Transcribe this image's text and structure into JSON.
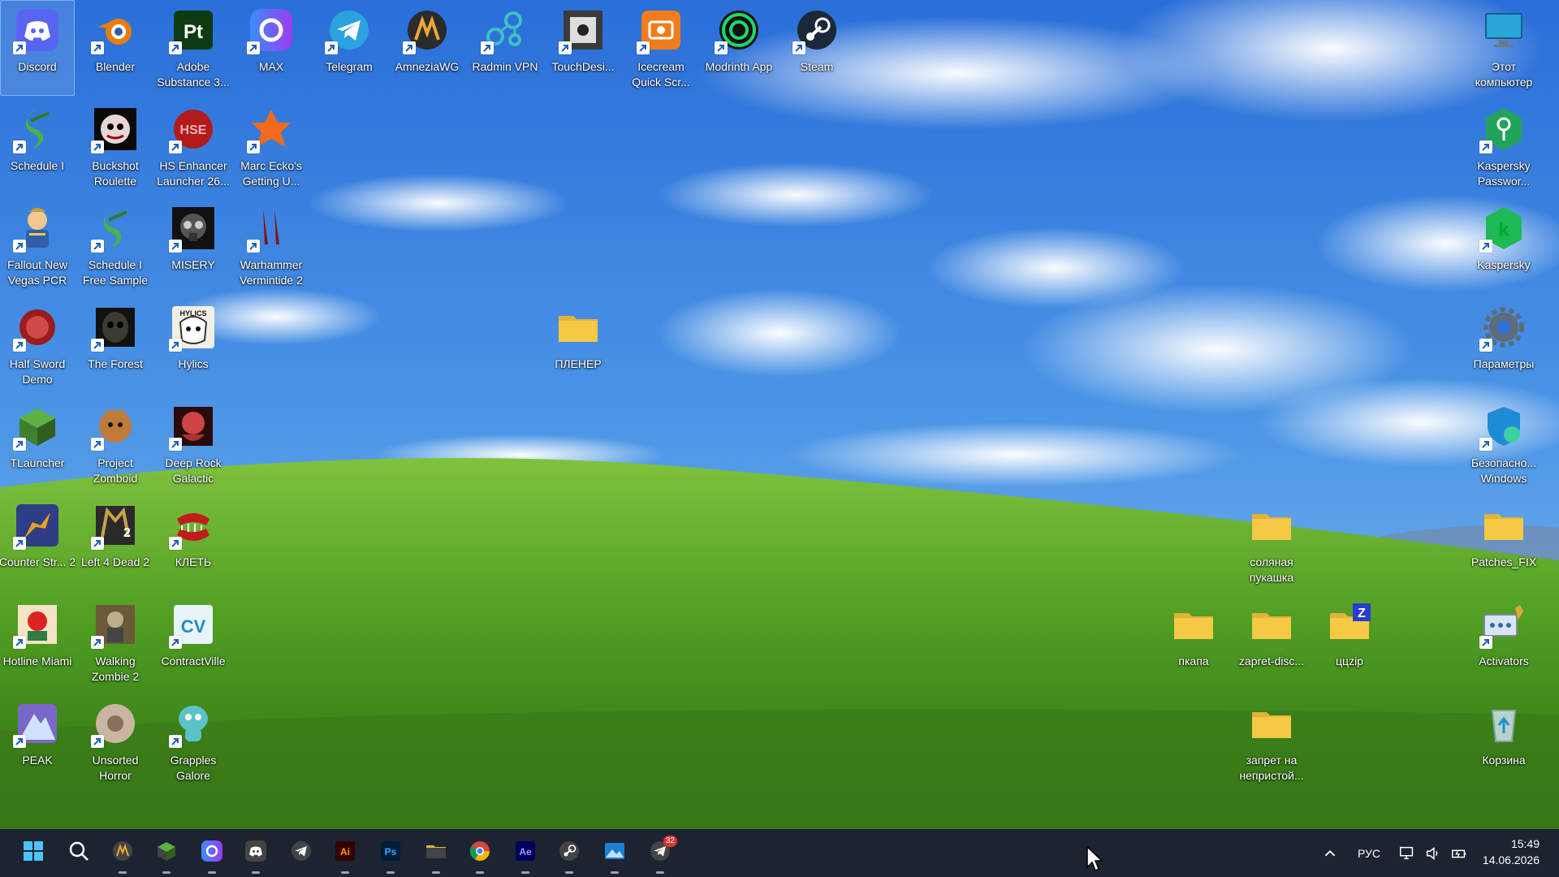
{
  "desktop": {
    "icons": [
      {
        "label": "Discord",
        "glyph": "discord",
        "color": "#5865f2"
      },
      {
        "label": "Blender",
        "glyph": "blender",
        "color": "#e87d0d"
      },
      {
        "label": "Adobe Substance 3...",
        "glyph": "Pt",
        "color": "#0f3b14"
      },
      {
        "label": "MAX",
        "glyph": "max",
        "color": "#6b46e5"
      },
      {
        "label": "Telegram",
        "glyph": "telegram",
        "color": "#2aa3e0"
      },
      {
        "label": "AmneziaWG",
        "glyph": "amnezia",
        "color": "#2b2b2b"
      },
      {
        "label": "Radmin VPN",
        "glyph": "radmin",
        "color": "#3cc1c5"
      },
      {
        "label": "TouchDesi...",
        "glyph": "touchdesigner",
        "color": "#3a3a3a"
      },
      {
        "label": "Icecream Quick Scr...",
        "glyph": "icecream",
        "color": "#f07c1b"
      },
      {
        "label": "Modrinth App",
        "glyph": "modrinth",
        "color": "#1bd96a"
      },
      {
        "label": "Steam",
        "glyph": "steam",
        "color": "#1b2838"
      },
      {
        "label": "Этот компьютер",
        "glyph": "pc",
        "color": "#2ba6d8"
      },
      {
        "label": "Schedule I",
        "glyph": "schedule",
        "color": "#4fae4b"
      },
      {
        "label": "Buckshot Roulette",
        "glyph": "buckshot",
        "color": "#3a1212"
      },
      {
        "label": "HS Enhancer Launcher 26...",
        "glyph": "hse",
        "color": "#b31b1b"
      },
      {
        "label": "Marc Ecko's Getting U...",
        "glyph": "ecko",
        "color": "#f26a1b"
      },
      {
        "label": "Kaspersky Passwor...",
        "glyph": "kpass",
        "color": "#21a35a"
      },
      {
        "label": "Fallout New Vegas PCR",
        "glyph": "fallout",
        "color": "#c9a34a"
      },
      {
        "label": "Schedule I Free Sample",
        "glyph": "schedule",
        "color": "#4fae4b"
      },
      {
        "label": "MISERY",
        "glyph": "misery",
        "color": "#2a2a2a"
      },
      {
        "label": "Warhammer Vermintide 2",
        "glyph": "vermintide",
        "color": "#8b1010"
      },
      {
        "label": "Kaspersky",
        "glyph": "kaspersky",
        "color": "#1db954"
      },
      {
        "label": "Half Sword Demo",
        "glyph": "halfsword",
        "color": "#9b1c1c"
      },
      {
        "label": "The Forest",
        "glyph": "forest",
        "color": "#3b3b30"
      },
      {
        "label": "Hylics",
        "glyph": "hylics",
        "color": "#f2f0e6"
      },
      {
        "label": "ПЛЕНЕР",
        "glyph": "folder",
        "color": "#f5c944"
      },
      {
        "label": "Параметры",
        "glyph": "gear",
        "color": "#5d6b7a"
      },
      {
        "label": "TLauncher",
        "glyph": "tlauncher",
        "color": "#3f7f2e"
      },
      {
        "label": "Project Zomboid",
        "glyph": "zomboid",
        "color": "#c07a3a"
      },
      {
        "label": "Deep Rock Galactic",
        "glyph": "drg",
        "color": "#7b1c1c"
      },
      {
        "label": "Безопасно... Windows",
        "glyph": "defender",
        "color": "#1f8ad6"
      },
      {
        "label": "Counter Str... 2",
        "glyph": "cs2",
        "color": "#e8a020"
      },
      {
        "label": "Left 4 Dead 2",
        "glyph": "l4d2",
        "color": "#2a2a2a"
      },
      {
        "label": "КЛЕТЬ",
        "glyph": "klet",
        "color": "#c21b1b"
      },
      {
        "label": "соляная пукашка",
        "glyph": "folder",
        "color": "#f5c944"
      },
      {
        "label": "Patches_FIX",
        "glyph": "folder",
        "color": "#f5c944"
      },
      {
        "label": "Hotline Miami",
        "glyph": "hotline",
        "color": "#2e7d43"
      },
      {
        "label": "Walking Zombie 2",
        "glyph": "walkingzombie",
        "color": "#6b5a3a"
      },
      {
        "label": "ContractVille",
        "glyph": "cv",
        "color": "#1f8fbf"
      },
      {
        "label": "пкапа",
        "glyph": "folder",
        "color": "#f5c944"
      },
      {
        "label": "zapret-disc...",
        "glyph": "folder",
        "color": "#f5c944"
      },
      {
        "label": "ццzip",
        "glyph": "zip",
        "color": "#f5c944"
      },
      {
        "label": "Activators",
        "glyph": "activators",
        "color": "#d9e6f2"
      },
      {
        "label": "PEAK",
        "glyph": "peak",
        "color": "#7a68c8"
      },
      {
        "label": "Unsorted Horror",
        "glyph": "unsorted",
        "color": "#c9b6a2"
      },
      {
        "label": "Grapples Galore",
        "glyph": "grapples",
        "color": "#5ac2c9"
      },
      {
        "label": "запрет на непристой...",
        "glyph": "folder",
        "color": "#f5c944"
      },
      {
        "label": "Корзина",
        "glyph": "recycle",
        "color": "#d6e8f5"
      }
    ]
  },
  "taskbar": {
    "apps": [
      {
        "name": "start-button",
        "glyph": "start"
      },
      {
        "name": "search-button",
        "glyph": "search"
      },
      {
        "name": "amnezia",
        "glyph": "amnezia"
      },
      {
        "name": "tlauncher",
        "glyph": "tlauncher"
      },
      {
        "name": "max",
        "glyph": "max"
      },
      {
        "name": "discord",
        "glyph": "discord"
      },
      {
        "name": "telegram",
        "glyph": "telegram"
      },
      {
        "name": "illustrator",
        "glyph": "Ai"
      },
      {
        "name": "photoshop",
        "glyph": "Ps"
      },
      {
        "name": "file-explorer",
        "glyph": "folder"
      },
      {
        "name": "chrome",
        "glyph": "chrome"
      },
      {
        "name": "after-effects",
        "glyph": "Ae"
      },
      {
        "name": "steam",
        "glyph": "steam"
      },
      {
        "name": "photos",
        "glyph": "photos"
      },
      {
        "name": "telegram-2",
        "glyph": "telegram"
      }
    ],
    "badge_count": "32",
    "lang": "РУС",
    "time": "15:49",
    "date": "14.06.2026"
  }
}
